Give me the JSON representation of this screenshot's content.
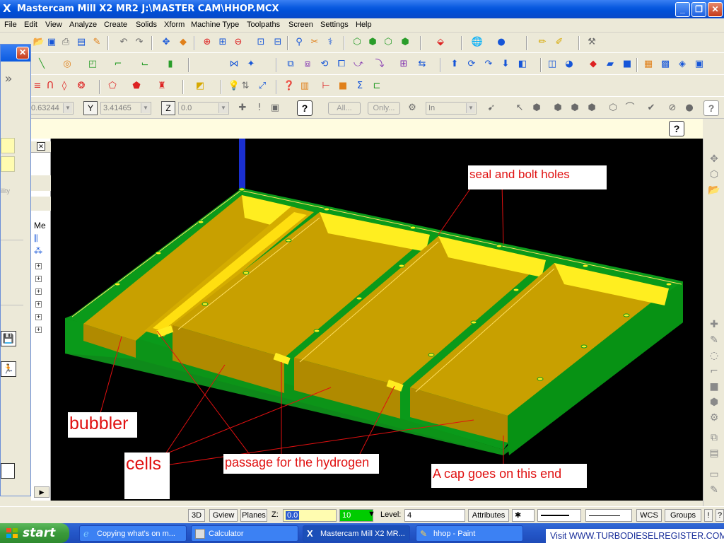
{
  "window": {
    "title": "Mastercam Mill X2 MR2  J:\\MASTER CAM\\HHOP.MCX",
    "app_icon": "X",
    "controls": [
      "minimize",
      "maximize",
      "close"
    ]
  },
  "menu": [
    "File",
    "Edit",
    "View",
    "Analyze",
    "Create",
    "Solids",
    "Xform",
    "Machine Type",
    "Toolpaths",
    "Screen",
    "Settings",
    "Help"
  ],
  "coordinates": {
    "x_value": "0.63244",
    "y_label": "Y",
    "y_value": "3.41465",
    "z_label": "Z",
    "z_value": "0.0",
    "all_label": "All...",
    "only_label": "Only...",
    "unit_value": "In"
  },
  "left_panel": {
    "close_label": "✕",
    "fragment_text": "ility",
    "tree_header": "Me"
  },
  "annotations": {
    "seal": "seal and bolt holes",
    "bubbler": "bubbler",
    "cells": "cells",
    "passage": "passage for the hydrogen",
    "cap": "A cap goes on this end"
  },
  "status_bar": {
    "btn_3d": "3D",
    "gview": "Gview",
    "planes": "Planes",
    "z_label": "Z:",
    "z_value": "0.0",
    "color_value": "10",
    "level_label": "Level:",
    "level_value": "4",
    "attributes": "Attributes",
    "wcs": "WCS",
    "groups": "Groups",
    "excl": "!",
    "help": "?"
  },
  "taskbar": {
    "start": "start",
    "tasks": [
      {
        "label": "Copying what's on m...",
        "icon": "ie-icon"
      },
      {
        "label": "Calculator",
        "icon": "calculator-icon"
      },
      {
        "label": "Mastercam Mill X2 MR...",
        "icon": "mastercam-icon"
      },
      {
        "label": "hhop - Paint",
        "icon": "paint-icon"
      }
    ],
    "banner": "Visit WWW.TURBODIESELREGISTER.COM"
  },
  "colors": {
    "part_green": "#0a9a1a",
    "pocket_gold": "#c8a000",
    "pocket_yellow": "#ffee20",
    "annotation_red": "#e01010",
    "background": "#000000"
  }
}
